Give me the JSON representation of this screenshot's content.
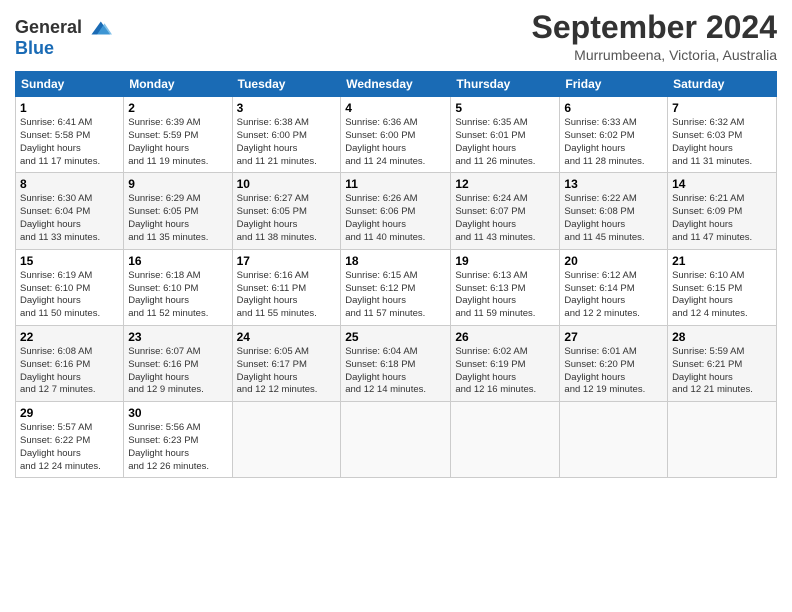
{
  "logo": {
    "line1": "General",
    "line2": "Blue"
  },
  "title": "September 2024",
  "location": "Murrumbeena, Victoria, Australia",
  "days_of_week": [
    "Sunday",
    "Monday",
    "Tuesday",
    "Wednesday",
    "Thursday",
    "Friday",
    "Saturday"
  ],
  "weeks": [
    [
      {
        "day": "1",
        "sunrise": "6:41 AM",
        "sunset": "5:58 PM",
        "daylight": "11 hours and 17 minutes."
      },
      {
        "day": "2",
        "sunrise": "6:39 AM",
        "sunset": "5:59 PM",
        "daylight": "11 hours and 19 minutes."
      },
      {
        "day": "3",
        "sunrise": "6:38 AM",
        "sunset": "6:00 PM",
        "daylight": "11 hours and 21 minutes."
      },
      {
        "day": "4",
        "sunrise": "6:36 AM",
        "sunset": "6:00 PM",
        "daylight": "11 hours and 24 minutes."
      },
      {
        "day": "5",
        "sunrise": "6:35 AM",
        "sunset": "6:01 PM",
        "daylight": "11 hours and 26 minutes."
      },
      {
        "day": "6",
        "sunrise": "6:33 AM",
        "sunset": "6:02 PM",
        "daylight": "11 hours and 28 minutes."
      },
      {
        "day": "7",
        "sunrise": "6:32 AM",
        "sunset": "6:03 PM",
        "daylight": "11 hours and 31 minutes."
      }
    ],
    [
      {
        "day": "8",
        "sunrise": "6:30 AM",
        "sunset": "6:04 PM",
        "daylight": "11 hours and 33 minutes."
      },
      {
        "day": "9",
        "sunrise": "6:29 AM",
        "sunset": "6:05 PM",
        "daylight": "11 hours and 35 minutes."
      },
      {
        "day": "10",
        "sunrise": "6:27 AM",
        "sunset": "6:05 PM",
        "daylight": "11 hours and 38 minutes."
      },
      {
        "day": "11",
        "sunrise": "6:26 AM",
        "sunset": "6:06 PM",
        "daylight": "11 hours and 40 minutes."
      },
      {
        "day": "12",
        "sunrise": "6:24 AM",
        "sunset": "6:07 PM",
        "daylight": "11 hours and 43 minutes."
      },
      {
        "day": "13",
        "sunrise": "6:22 AM",
        "sunset": "6:08 PM",
        "daylight": "11 hours and 45 minutes."
      },
      {
        "day": "14",
        "sunrise": "6:21 AM",
        "sunset": "6:09 PM",
        "daylight": "11 hours and 47 minutes."
      }
    ],
    [
      {
        "day": "15",
        "sunrise": "6:19 AM",
        "sunset": "6:10 PM",
        "daylight": "11 hours and 50 minutes."
      },
      {
        "day": "16",
        "sunrise": "6:18 AM",
        "sunset": "6:10 PM",
        "daylight": "11 hours and 52 minutes."
      },
      {
        "day": "17",
        "sunrise": "6:16 AM",
        "sunset": "6:11 PM",
        "daylight": "11 hours and 55 minutes."
      },
      {
        "day": "18",
        "sunrise": "6:15 AM",
        "sunset": "6:12 PM",
        "daylight": "11 hours and 57 minutes."
      },
      {
        "day": "19",
        "sunrise": "6:13 AM",
        "sunset": "6:13 PM",
        "daylight": "11 hours and 59 minutes."
      },
      {
        "day": "20",
        "sunrise": "6:12 AM",
        "sunset": "6:14 PM",
        "daylight": "12 hours and 2 minutes."
      },
      {
        "day": "21",
        "sunrise": "6:10 AM",
        "sunset": "6:15 PM",
        "daylight": "12 hours and 4 minutes."
      }
    ],
    [
      {
        "day": "22",
        "sunrise": "6:08 AM",
        "sunset": "6:16 PM",
        "daylight": "12 hours and 7 minutes."
      },
      {
        "day": "23",
        "sunrise": "6:07 AM",
        "sunset": "6:16 PM",
        "daylight": "12 hours and 9 minutes."
      },
      {
        "day": "24",
        "sunrise": "6:05 AM",
        "sunset": "6:17 PM",
        "daylight": "12 hours and 12 minutes."
      },
      {
        "day": "25",
        "sunrise": "6:04 AM",
        "sunset": "6:18 PM",
        "daylight": "12 hours and 14 minutes."
      },
      {
        "day": "26",
        "sunrise": "6:02 AM",
        "sunset": "6:19 PM",
        "daylight": "12 hours and 16 minutes."
      },
      {
        "day": "27",
        "sunrise": "6:01 AM",
        "sunset": "6:20 PM",
        "daylight": "12 hours and 19 minutes."
      },
      {
        "day": "28",
        "sunrise": "5:59 AM",
        "sunset": "6:21 PM",
        "daylight": "12 hours and 21 minutes."
      }
    ],
    [
      {
        "day": "29",
        "sunrise": "5:57 AM",
        "sunset": "6:22 PM",
        "daylight": "12 hours and 24 minutes."
      },
      {
        "day": "30",
        "sunrise": "5:56 AM",
        "sunset": "6:23 PM",
        "daylight": "12 hours and 26 minutes."
      },
      null,
      null,
      null,
      null,
      null
    ]
  ]
}
